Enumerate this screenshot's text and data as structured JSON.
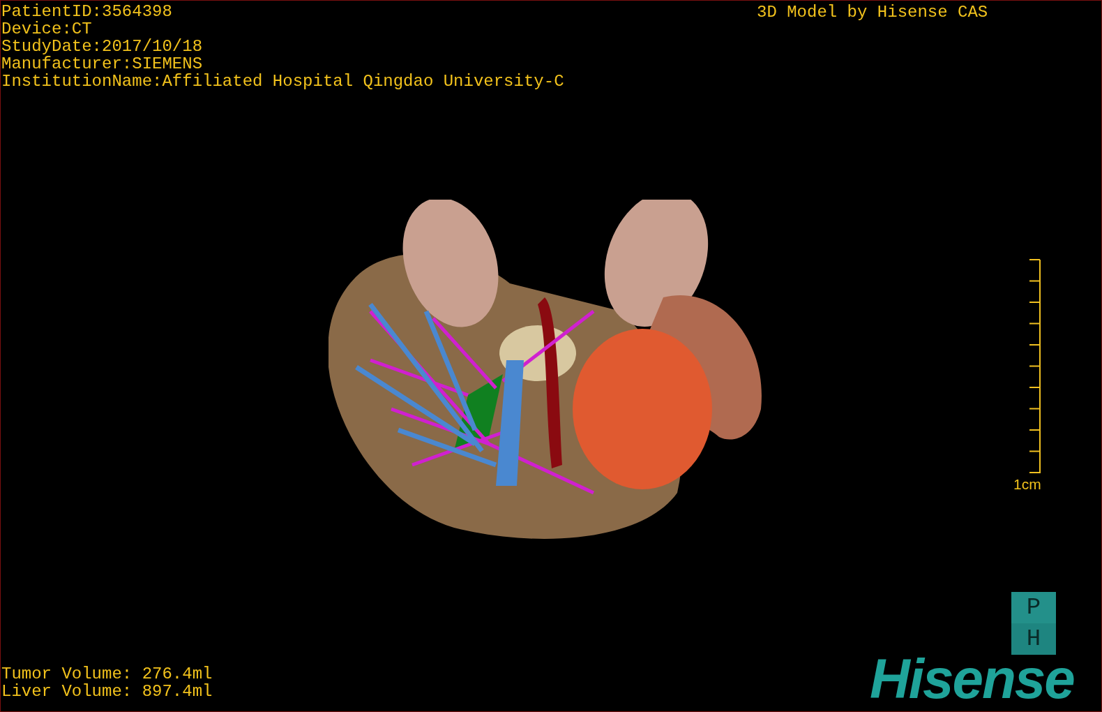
{
  "viewer": {
    "patient_info": [
      "PatientID:3564398",
      "Device:CT",
      "StudyDate:2017/10/18",
      "Manufacturer:SIEMENS",
      "InstitutionName:Affiliated Hospital Qingdao University-C"
    ],
    "title": "3D Model by Hisense CAS",
    "scale_bar": {
      "label": "1cm"
    },
    "volumes": [
      "Tumor Volume: 276.4ml",
      "Liver Volume: 897.4ml"
    ],
    "view_cube": [
      "P",
      "H"
    ],
    "logo": "Hisense"
  }
}
